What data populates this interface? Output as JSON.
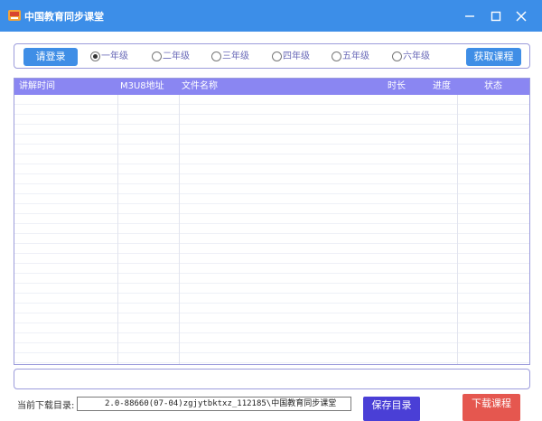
{
  "window": {
    "title": "中国教育同步课堂"
  },
  "toolbar": {
    "login_label": "请登录",
    "get_courses_label": "获取课程",
    "grades": [
      {
        "label": "一年级",
        "checked": true
      },
      {
        "label": "二年级",
        "checked": false
      },
      {
        "label": "三年级",
        "checked": false
      },
      {
        "label": "四年级",
        "checked": false
      },
      {
        "label": "五年级",
        "checked": false
      },
      {
        "label": "六年级",
        "checked": false
      }
    ]
  },
  "table": {
    "columns": [
      "讲解时间",
      "M3U8地址",
      "文件名称",
      "时长",
      "进度",
      "状态"
    ],
    "rows": []
  },
  "status_bar": {
    "text": ""
  },
  "footer": {
    "dir_label": "当前下载目录:",
    "dir_value": "2.0-88660(07-04)zgjytbktxz_112185\\中国教育同步课堂",
    "save_dir_label": "保存目录",
    "download_label": "下载课程"
  },
  "colors": {
    "titlebar": "#3c8ee8",
    "button_blue": "#3f8ee6",
    "table_header": "#8a86f2",
    "save_button": "#4a3fd6",
    "download_button": "#e5574f"
  }
}
